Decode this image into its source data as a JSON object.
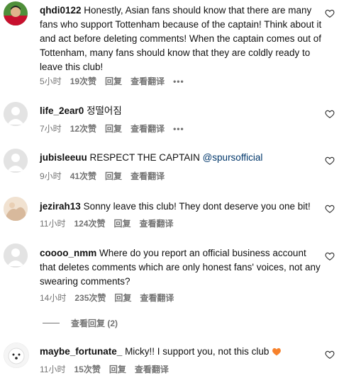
{
  "comments": [
    {
      "username": "qhdi0122",
      "text": "Honestly, Asian fans should know that there are many fans who support Tottenham because of the captain! Think about it and act before deleting comments! When the captain comes out of Tottenham, many fans should know that they are coldly ready to leave this club!",
      "time": "5小时",
      "likes": "19次赞",
      "reply": "回复",
      "translate": "查看翻译",
      "more": "•••"
    },
    {
      "username": "life_2ear0",
      "text": "정떨어짐",
      "time": "7小时",
      "likes": "12次赞",
      "reply": "回复",
      "translate": "查看翻译",
      "more": "•••"
    },
    {
      "username": "jubisleeuu",
      "text": "RESPECT THE CAPTAIN",
      "mention": "@spursofficial",
      "time": "9小时",
      "likes": "41次赞",
      "reply": "回复",
      "translate": "查看翻译"
    },
    {
      "username": "jezirah13",
      "text": "Sonny leave this club! They dont deserve you one bit!",
      "time": "11小时",
      "likes": "124次赞",
      "reply": "回复",
      "translate": "查看翻译"
    },
    {
      "username": "coooo_nmm",
      "text": "Where do you report an official business account that deletes comments which are only honest fans' voices, not any swearing comments?",
      "time": "14小时",
      "likes": "235次赞",
      "reply": "回复",
      "translate": "查看翻译"
    },
    {
      "username": "maybe_fortunate_",
      "text": "Micky!! I support you, not this club",
      "time": "11小时",
      "likes": "15次赞",
      "reply": "回复",
      "translate": "查看翻译"
    }
  ],
  "view_replies": "查看回复 (2)",
  "colors": {
    "meta": "#737373",
    "mention": "#00376b",
    "heart_emoji": "#f7812b"
  }
}
